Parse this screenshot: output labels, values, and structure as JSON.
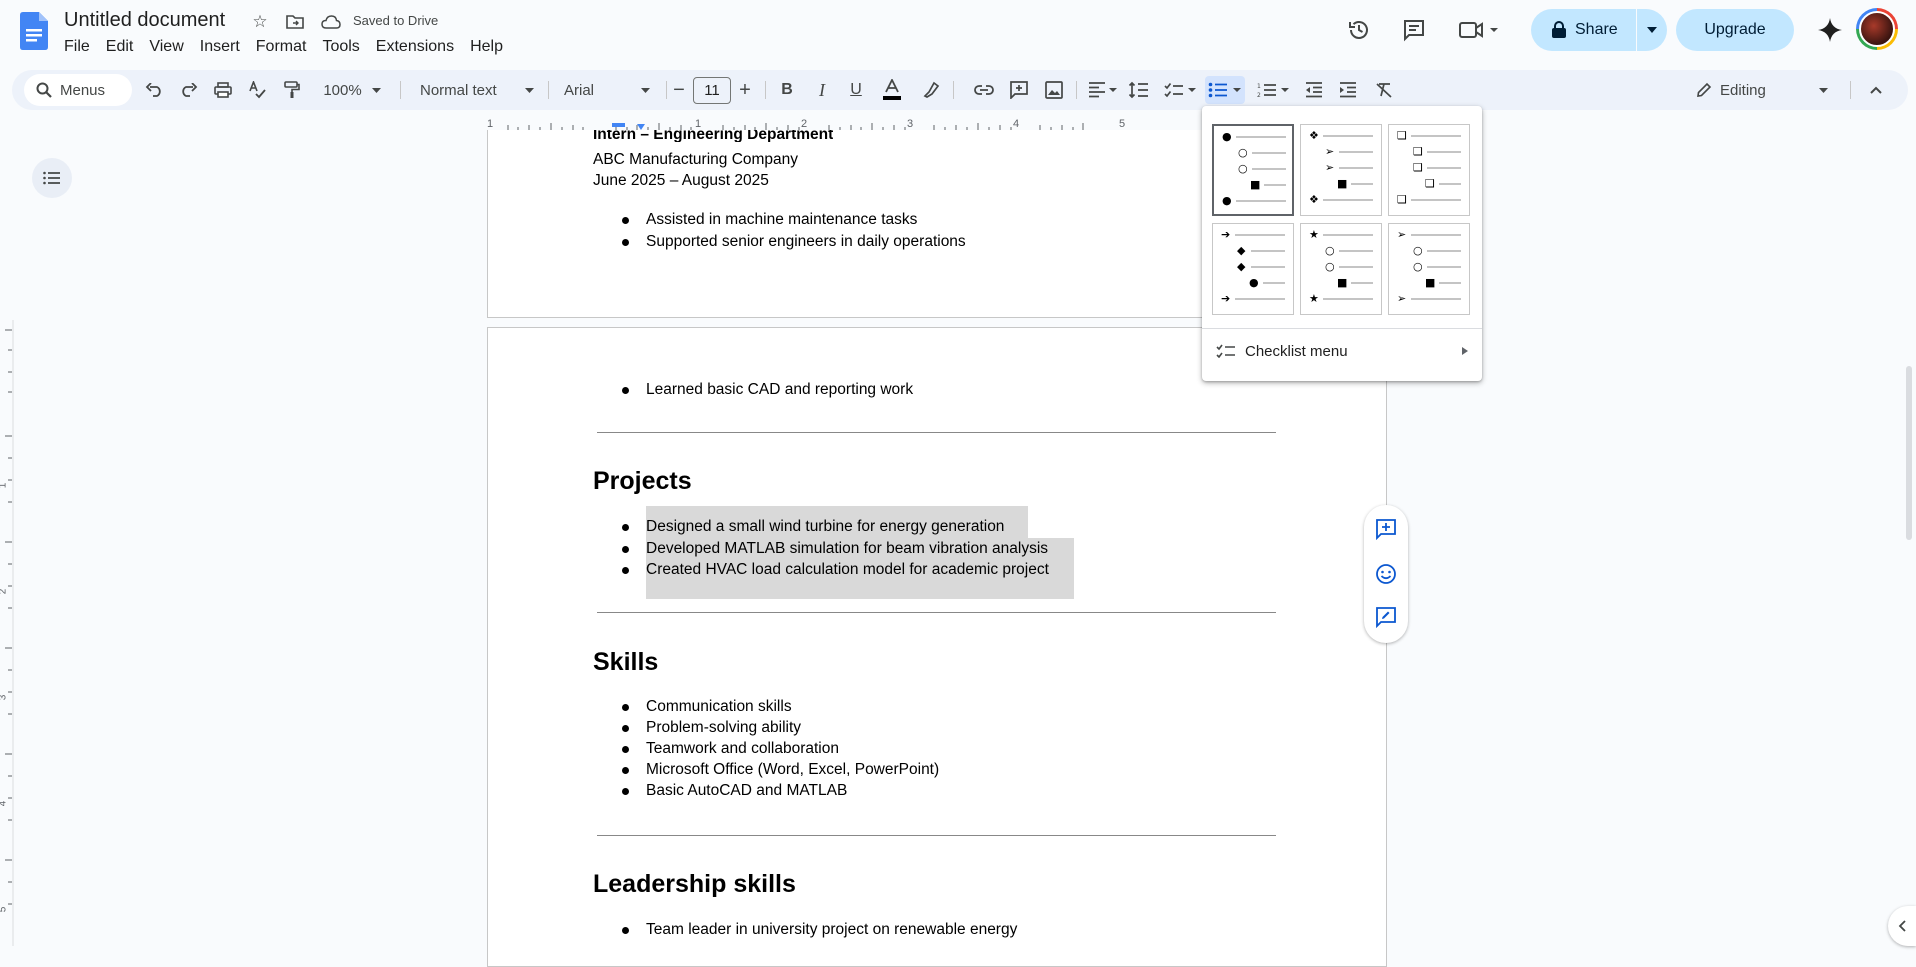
{
  "header": {
    "doc_title": "Untitled document",
    "saved_status": "Saved to Drive",
    "menus": [
      "File",
      "Edit",
      "View",
      "Insert",
      "Format",
      "Tools",
      "Extensions",
      "Help"
    ],
    "share_label": "Share",
    "upgrade_label": "Upgrade"
  },
  "toolbar": {
    "search_placeholder": "Menus",
    "zoom": "100%",
    "style": "Normal text",
    "font": "Arial",
    "font_size": "11",
    "mode": "Editing"
  },
  "ruler": {
    "labels": [
      "1",
      "1",
      "2",
      "3",
      "4",
      "5"
    ]
  },
  "vruler": {
    "labels": [
      "1",
      "2",
      "3",
      "4",
      "5"
    ]
  },
  "document": {
    "page1": {
      "job_title": "Intern – Engineering Department",
      "company": "ABC Manufacturing Company",
      "dates": "June 2025 – August 2025",
      "bullets": [
        "Assisted in machine maintenance tasks",
        "Supported senior engineers in daily operations"
      ]
    },
    "page2": {
      "top_bullet": "Learned basic CAD and reporting work",
      "projects_heading": "Projects",
      "projects": [
        "Designed a small wind turbine for energy generation",
        "Developed MATLAB simulation for beam vibration analysis",
        "Created HVAC load calculation model for academic project"
      ],
      "skills_heading": "Skills",
      "skills": [
        "Communication skills",
        "Problem-solving ability",
        "Teamwork and collaboration",
        "Microsoft Office (Word, Excel, PowerPoint)",
        "Basic AutoCAD and MATLAB"
      ],
      "leadership_heading": "Leadership skills",
      "leadership": [
        "Team leader in university project on renewable energy"
      ]
    }
  },
  "bullet_menu": {
    "checklist_label": "Checklist menu",
    "presets": [
      [
        "●",
        "○",
        "○",
        "■",
        "●"
      ],
      [
        "❖",
        "➢",
        "➢",
        "■",
        "❖"
      ],
      [
        "❑",
        "❑",
        "❑",
        "❑",
        "❑"
      ],
      [
        "➔",
        "◆",
        "◆",
        "●",
        "➔"
      ],
      [
        "★",
        "○",
        "○",
        "■",
        "★"
      ],
      [
        "➢",
        "○",
        "○",
        "■",
        "➢"
      ]
    ]
  }
}
